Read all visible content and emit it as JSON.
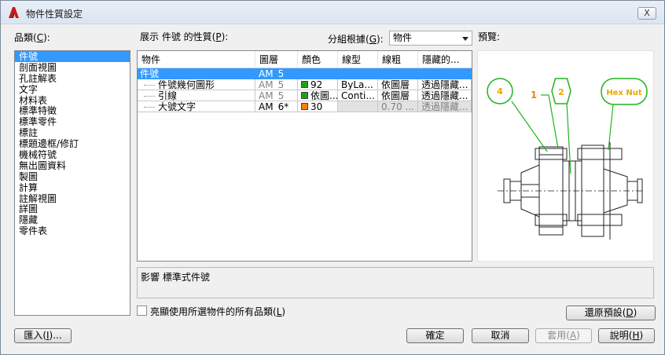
{
  "window": {
    "title": "物件性質設定",
    "close_label": "X"
  },
  "categories": {
    "label": "品類(",
    "label_key": "C",
    "label_end": "):",
    "items": [
      "件號",
      "剖面視圖",
      "孔註解表",
      "文字",
      "材料表",
      "標準特徵",
      "標準零件",
      "標註",
      "標題邊框/修訂",
      "機械符號",
      "無出圖資料",
      "製圖",
      "計算",
      "註解視圖",
      "詳圖",
      "隱藏",
      "零件表"
    ],
    "selected_index": 0
  },
  "properties": {
    "label": "展示 件號 的性質(",
    "label_key": "P",
    "label_end": "):",
    "columns": [
      "物件",
      "圖層",
      "顏色",
      "線型",
      "線粗",
      "隱藏的..."
    ],
    "rows": [
      {
        "object": "件號",
        "layer": "AM_5",
        "color_swatch": "",
        "color": "",
        "linetype": "",
        "lineweight": "",
        "hidden": ""
      },
      {
        "object": "件號幾何圖形",
        "layer": "AM_5",
        "color_swatch": "#1aa31a",
        "color": "92",
        "linetype": "ByLa...",
        "lineweight": "依圖層",
        "hidden": "透過隱藏..."
      },
      {
        "object": "引線",
        "layer": "AM_5",
        "color_swatch": "#1aa31a",
        "color": "依圖...",
        "linetype": "Conti...",
        "lineweight": "依圖層",
        "hidden": "透過隱藏..."
      },
      {
        "object": "大號文字",
        "layer": "AM_6*",
        "color_swatch": "#ff8000",
        "color": "30",
        "linetype": "",
        "lineweight": "0.70 ...",
        "hidden": "透過隱藏..."
      }
    ]
  },
  "group_by": {
    "label": "分組根據(",
    "label_key": "G",
    "label_end": "):",
    "value": "物件"
  },
  "preview": {
    "label": "預覽:",
    "balloons": [
      "4",
      "1",
      "2",
      "Hex Nut"
    ],
    "accent_color": "#22b222",
    "balloon_text_color": "#e6a800",
    "leader_text_color": "#ff8000"
  },
  "description": {
    "text": "影響 標準式件號"
  },
  "checkbox": {
    "label": "亮顯使用所選物件的所有品類(",
    "label_key": "L",
    "label_end": ")",
    "checked": false
  },
  "buttons": {
    "reset": {
      "label": "還原預設(",
      "key": "D",
      "end": ")"
    },
    "import": {
      "label": "匯入(",
      "key": "I",
      "end": ")..."
    },
    "ok": {
      "label": "確定"
    },
    "cancel": {
      "label": "取消"
    },
    "apply": {
      "label": "套用(",
      "key": "A",
      "end": ")"
    },
    "help": {
      "label": "說明(",
      "key": "H",
      "end": ")"
    }
  }
}
